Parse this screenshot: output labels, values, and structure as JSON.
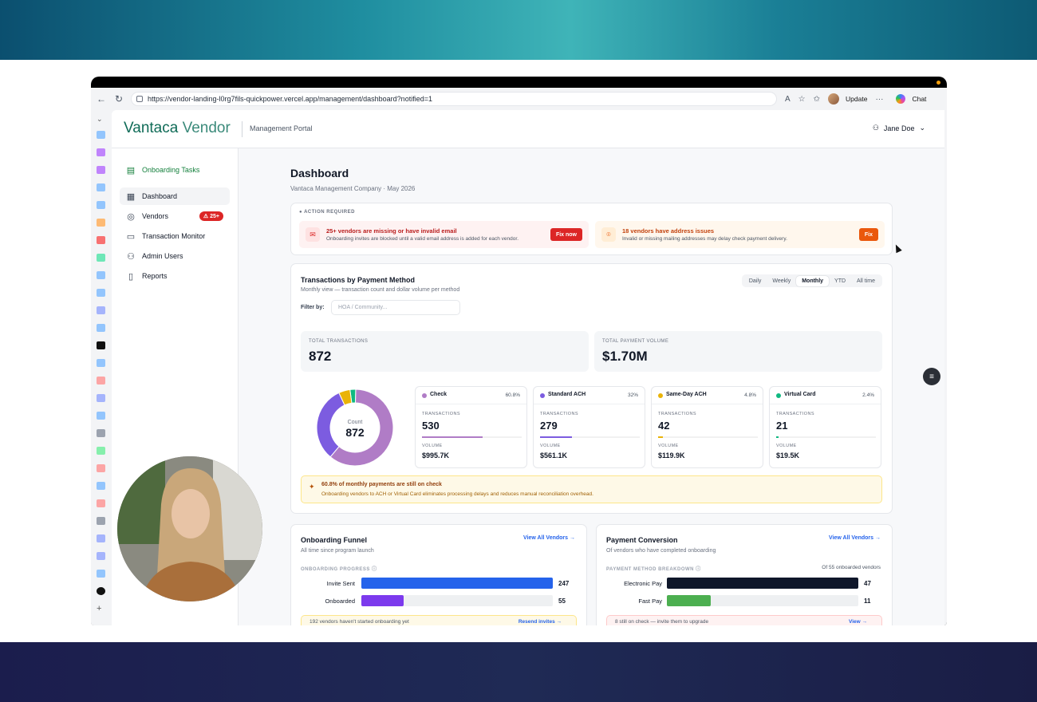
{
  "browser": {
    "url": "https://vendor-landing-l0rg7fils-quickpower.vercel.app/management/dashboard?notified=1",
    "update_label": "Update",
    "chat_label": "Chat"
  },
  "header": {
    "logo_brand": "Vantaca",
    "logo_product": "Vendor",
    "portal_label": "Management Portal",
    "user_name": "Jane Doe"
  },
  "sidebar": {
    "items": [
      {
        "label": "Onboarding Tasks",
        "icon": "clipboard-icon"
      },
      {
        "label": "Dashboard",
        "icon": "grid-icon"
      },
      {
        "label": "Vendors",
        "icon": "globe-icon",
        "badge": "25+"
      },
      {
        "label": "Transaction Monitor",
        "icon": "card-icon"
      },
      {
        "label": "Admin Users",
        "icon": "user-icon"
      },
      {
        "label": "Reports",
        "icon": "document-icon"
      }
    ]
  },
  "page": {
    "title": "Dashboard",
    "subtitle": "Vantaca Management Company · May 2026"
  },
  "action_required": {
    "label": "ACTION REQUIRED",
    "alerts": [
      {
        "title": "25+ vendors are missing or have invalid email",
        "desc": "Onboarding invites are blocked until a valid email address is added for each vendor.",
        "button": "Fix now",
        "color": "#dc2626"
      },
      {
        "title": "18 vendors have address issues",
        "desc": "Invalid or missing mailing addresses may delay check payment delivery.",
        "button": "Fix",
        "color": "#ea580c"
      }
    ]
  },
  "transactions": {
    "title": "Transactions by Payment Method",
    "subtitle": "Monthly view — transaction count and dollar volume per method",
    "filter_label": "Filter by:",
    "filter_placeholder": "HOA / Community...",
    "periods": [
      "Daily",
      "Weekly",
      "Monthly",
      "YTD",
      "All time"
    ],
    "selected_period": "Monthly",
    "total_transactions_label": "TOTAL TRANSACTIONS",
    "total_transactions": "872",
    "total_volume_label": "TOTAL PAYMENT VOLUME",
    "total_volume": "$1.70M",
    "donut_label": "Count",
    "donut_value": "872",
    "transactions_label": "TRANSACTIONS",
    "volume_label": "VOLUME",
    "methods": [
      {
        "name": "Check",
        "pct": "60.8%",
        "share": 0.608,
        "transactions": "530",
        "volume": "$995.7K",
        "color": "#b07cc6"
      },
      {
        "name": "Standard ACH",
        "pct": "32%",
        "share": 0.32,
        "transactions": "279",
        "volume": "$561.1K",
        "color": "#7c5ce0"
      },
      {
        "name": "Same-Day ACH",
        "pct": "4.8%",
        "share": 0.048,
        "transactions": "42",
        "volume": "$119.9K",
        "color": "#eab308"
      },
      {
        "name": "Virtual Card",
        "pct": "2.4%",
        "share": 0.024,
        "transactions": "21",
        "volume": "$19.5K",
        "color": "#10b981"
      }
    ],
    "insight_title": "60.8% of monthly payments are still on check",
    "insight_desc": "Onboarding vendors to ACH or Virtual Card eliminates processing delays and reduces manual reconciliation overhead."
  },
  "funnel": {
    "title": "Onboarding Funnel",
    "subtitle": "All time since program launch",
    "link": "View All Vendors →",
    "section": "ONBOARDING PROGRESS",
    "rows": [
      {
        "label": "Invite Sent",
        "value": "247",
        "share": 1.0,
        "color": "#2563eb"
      },
      {
        "label": "Onboarded",
        "value": "55",
        "share": 0.22,
        "color": "#7c3aed"
      }
    ],
    "footer": "192 vendors haven't started onboarding yet",
    "footer_link": "Resend invites →"
  },
  "conversion": {
    "title": "Payment Conversion",
    "subtitle": "Of vendors who have completed onboarding",
    "link": "View All Vendors →",
    "section": "PAYMENT METHOD BREAKDOWN",
    "section_right": "Of 55 onboarded vendors",
    "rows": [
      {
        "label": "Electronic Pay",
        "value": "47",
        "share": 1.0,
        "color": "#0f172a"
      },
      {
        "label": "Fast Pay",
        "value": "11",
        "share": 0.23,
        "color": "#4caf50"
      }
    ],
    "footer": "8 still on check — invite them to upgrade",
    "footer_link": "View →"
  },
  "chart_data": {
    "type": "pie",
    "categories": [
      "Check",
      "Standard ACH",
      "Same-Day ACH",
      "Virtual Card"
    ],
    "values": [
      530,
      279,
      42,
      21
    ]
  }
}
